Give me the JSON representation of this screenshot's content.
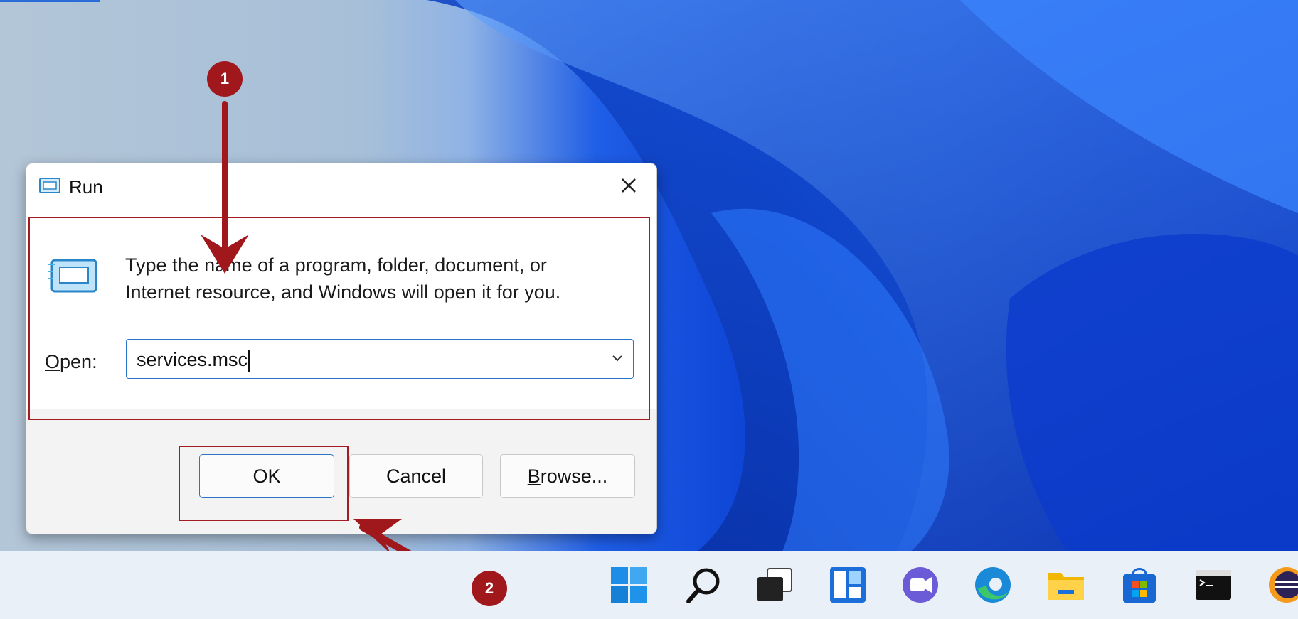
{
  "dialog": {
    "title": "Run",
    "description": "Type the name of a program, folder, document, or Internet resource, and Windows will open it for you.",
    "open_label_u": "O",
    "open_label_rest": "pen:",
    "open_value": "services.msc",
    "ok_label": "OK",
    "cancel_label": "Cancel",
    "browse_u": "B",
    "browse_rest": "rowse..."
  },
  "annotations": {
    "step1": "1",
    "step2": "2",
    "color": "#a0181c"
  },
  "taskbar": {
    "icons": [
      "windows-start-icon",
      "search-icon",
      "task-view-icon",
      "widgets-icon",
      "chat-icon",
      "edge-icon",
      "file-explorer-icon",
      "store-icon",
      "terminal-icon",
      "eclipse-icon"
    ]
  },
  "colors": {
    "accent": "#2a73c6",
    "desktop_blue": "#0a3fd2"
  }
}
